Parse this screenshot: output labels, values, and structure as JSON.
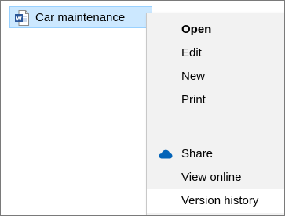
{
  "file": {
    "name": "Car maintenance",
    "icon": "word-document-icon",
    "icon_color": "#2b579a"
  },
  "context_menu": {
    "items": [
      {
        "label": "Open",
        "default": true
      },
      {
        "label": "Edit"
      },
      {
        "label": "New"
      },
      {
        "label": "Print"
      },
      {
        "label": "Share",
        "icon": "onedrive-cloud-icon",
        "icon_color": "#0364b8"
      },
      {
        "label": "View online"
      },
      {
        "label": "Version history",
        "hovered": true
      }
    ]
  }
}
